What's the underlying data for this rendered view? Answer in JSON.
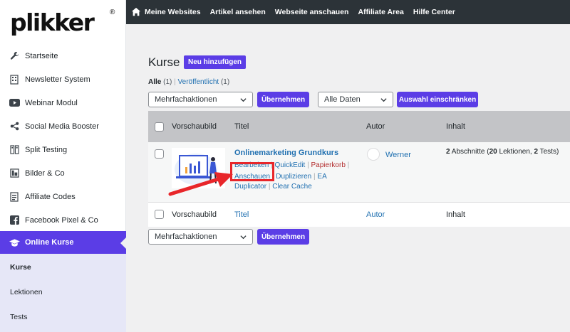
{
  "logo": {
    "text": "plikker",
    "reg": "®"
  },
  "sidebar": {
    "items": [
      {
        "label": "Startseite",
        "icon": "wrench-icon"
      },
      {
        "label": "Newsletter System",
        "icon": "newsletter-icon"
      },
      {
        "label": "Webinar Modul",
        "icon": "youtube-icon"
      },
      {
        "label": "Social Media Booster",
        "icon": "share-icon"
      },
      {
        "label": "Split Testing",
        "icon": "split-icon"
      },
      {
        "label": "Bilder & Co",
        "icon": "image-icon"
      },
      {
        "label": "Affiliate Codes",
        "icon": "code-icon"
      },
      {
        "label": "Facebook Pixel & Co",
        "icon": "facebook-icon"
      },
      {
        "label": "Online Kurse",
        "icon": "graduation-cap-icon",
        "active": true
      }
    ],
    "subitems": [
      {
        "label": "Kurse",
        "current": true
      },
      {
        "label": "Lektionen"
      },
      {
        "label": "Tests"
      }
    ]
  },
  "topbar": {
    "items": [
      "Meine Websites",
      "Artikel ansehen",
      "Webseite anschauen",
      "Affiliate Area",
      "Hilfe Center"
    ]
  },
  "page": {
    "title": "Kurse",
    "add_new": "Neu hinzufügen",
    "filter_all": "Alle",
    "filter_all_count": "(1)",
    "filter_sep": "|",
    "filter_published": "Veröffentlicht",
    "filter_published_count": "(1)"
  },
  "toolbar": {
    "bulk_select": "Mehrfachaktionen",
    "apply": "Übernehmen",
    "date_select": "Alle Daten",
    "filter_btn": "Auswahl einschränken"
  },
  "table": {
    "columns": [
      "Vorschaubild",
      "Titel",
      "Autor",
      "Inhalt"
    ],
    "row": {
      "title": "Onlinemarketing Grundkurs",
      "actions_line1": [
        "Bearbeiten",
        "QuickEdit",
        "Papierkorb"
      ],
      "actions_line2": [
        "Anschauen",
        "Duplizieren",
        "EA"
      ],
      "actions_line3": [
        "Duplicator",
        "Clear Cache"
      ],
      "author": "Werner",
      "content": {
        "sections_n": "2",
        "sections_label": "Abschnitte",
        "lessons_n": "20",
        "lessons_label": "Lektionen",
        "tests_n": "2",
        "tests_label": "Tests"
      }
    }
  },
  "bottom": {
    "bulk_select": "Mehrfachaktionen",
    "apply": "Übernehmen"
  },
  "colors": {
    "accent": "#5b3de6",
    "topbar": "#2c3338",
    "link": "#2271b1",
    "danger": "#b32d2e",
    "annotation": "#e8262a"
  }
}
